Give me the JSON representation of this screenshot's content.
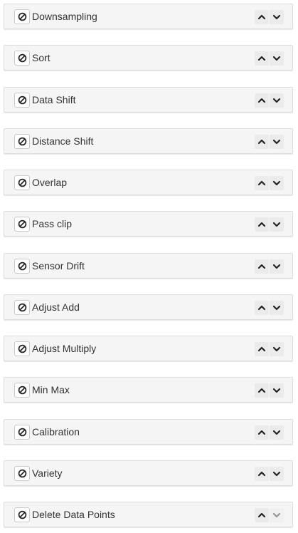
{
  "icons": {
    "toggle": "disable-icon",
    "move_up": "chevron-up-icon",
    "move_down": "chevron-down-icon"
  },
  "colors": {
    "panel_background": "#f5f5f5",
    "panel_border": "#dddddd",
    "text": "#333333",
    "icon": "#222222"
  },
  "panels": [
    {
      "label": "Downsampling",
      "move_down_enabled": true
    },
    {
      "label": "Sort",
      "move_down_enabled": true
    },
    {
      "label": "Data Shift",
      "move_down_enabled": true
    },
    {
      "label": "Distance Shift",
      "move_down_enabled": true
    },
    {
      "label": "Overlap",
      "move_down_enabled": true
    },
    {
      "label": "Pass clip",
      "move_down_enabled": true
    },
    {
      "label": "Sensor Drift",
      "move_down_enabled": true
    },
    {
      "label": "Adjust Add",
      "move_down_enabled": true
    },
    {
      "label": "Adjust Multiply",
      "move_down_enabled": true
    },
    {
      "label": "Min Max",
      "move_down_enabled": true
    },
    {
      "label": "Calibration",
      "move_down_enabled": true
    },
    {
      "label": "Variety",
      "move_down_enabled": true
    },
    {
      "label": "Delete Data Points",
      "move_down_enabled": false
    }
  ]
}
